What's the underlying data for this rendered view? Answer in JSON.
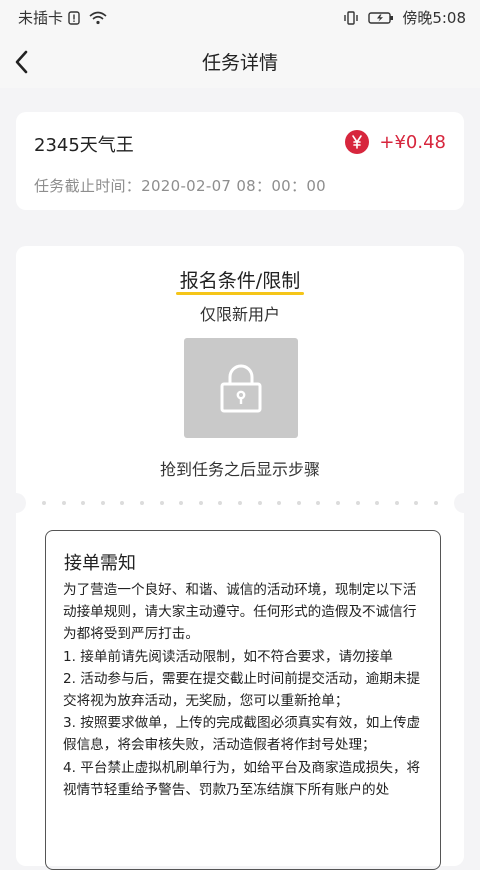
{
  "status_bar": {
    "carrier": "未插卡",
    "time": "傍晚5:08"
  },
  "header": {
    "title": "任务详情"
  },
  "task": {
    "app_name": "2345天气王",
    "reward": "+¥0.48",
    "deadline": "任务截止时间：2020-02-07 08：00：00"
  },
  "conditions": {
    "title": "报名条件/限制",
    "limit_text": "仅限新用户",
    "steps_hint": "抢到任务之后显示步骤"
  },
  "notice": {
    "title": "接单需知",
    "paragraphs": [
      "为了营造一个良好、和谐、诚信的活动环境，现制定以下活动接单规则，请大家主动遵守。任何形式的造假及不诚信行为都将受到严厉打击。",
      "1. 接单前请先阅读活动限制，如不符合要求，请勿接单",
      "2. 活动参与后，需要在提交截止时间前提交活动，逾期未提交将视为放弃活动，无奖励，您可以重新抢单；",
      "3. 按照要求做单，上传的完成截图必须真实有效，如上传虚假信息，将会审核失败，活动造假者将作封号处理；",
      "4. 平台禁止虚拟机刷单行为，如给平台及商家造成损失，将视情节轻重给予警告、罚款乃至冻结旗下所有账户的处"
    ]
  },
  "colors": {
    "accent_red": "#d7263d",
    "highlight_yellow": "#f5c518"
  }
}
